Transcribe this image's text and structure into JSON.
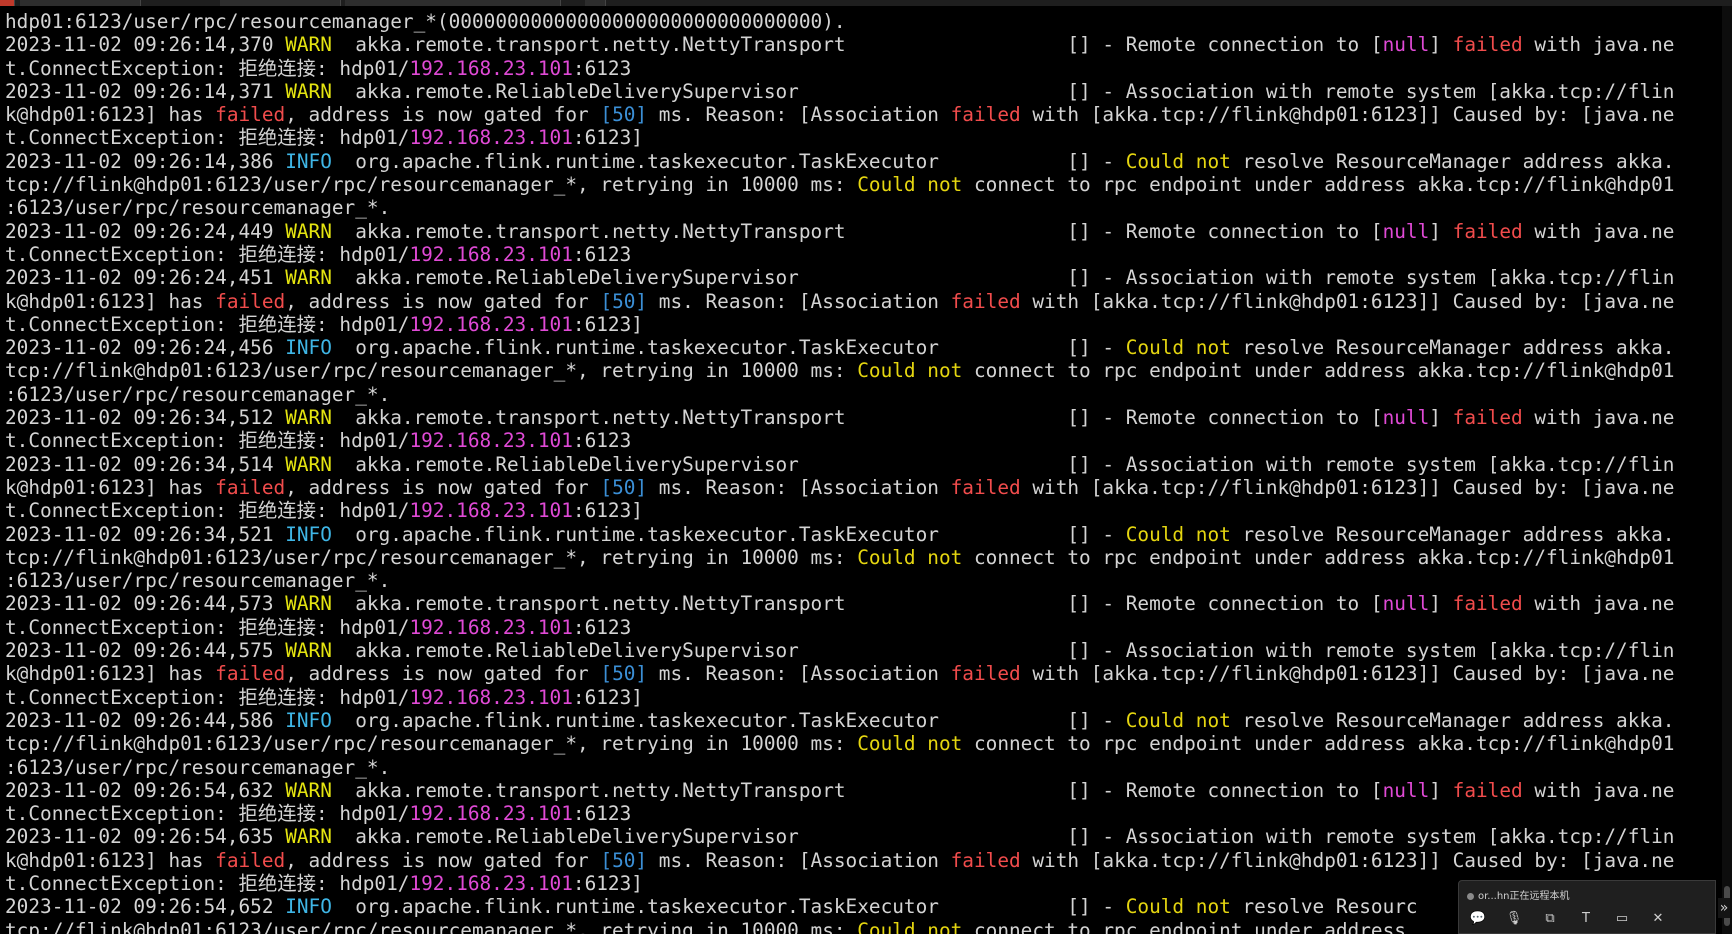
{
  "terminal": {
    "lines": [
      {
        "segs": [
          {
            "t": "hdp01:6123/user/rpc/resourcemanager_*(00000000000000000000000000000000)."
          }
        ]
      },
      {
        "segs": [
          {
            "t": "2023-11-02 09:26:14,370 "
          },
          {
            "t": "WARN",
            "c": "warn"
          },
          {
            "t": "  akka.remote.transport.netty.NettyTransport                   [] - Remote connection to ["
          },
          {
            "t": "null",
            "c": "mag"
          },
          {
            "t": "] "
          },
          {
            "t": "failed",
            "c": "red"
          },
          {
            "t": " with java.ne"
          }
        ]
      },
      {
        "segs": [
          {
            "t": "t.ConnectException: "
          },
          {
            "t": "拒绝连接",
            "c": "cjk"
          },
          {
            "t": ": hdp01/"
          },
          {
            "t": "192.168.23.101",
            "c": "mag"
          },
          {
            "t": ":6123"
          }
        ]
      },
      {
        "segs": [
          {
            "t": "2023-11-02 09:26:14,371 "
          },
          {
            "t": "WARN",
            "c": "warn"
          },
          {
            "t": "  akka.remote.ReliableDeliverySupervisor                       [] - Association with remote system [akka.tcp://flin"
          }
        ]
      },
      {
        "segs": [
          {
            "t": "k@hdp01:6123] has "
          },
          {
            "t": "failed",
            "c": "red"
          },
          {
            "t": ", address is now gated for "
          },
          {
            "t": "[50]",
            "c": "blue"
          },
          {
            "t": " ms. Reason: [Association "
          },
          {
            "t": "failed",
            "c": "red"
          },
          {
            "t": " with [akka.tcp://flink@hdp01:6123]] Caused by: [java.ne"
          }
        ]
      },
      {
        "segs": [
          {
            "t": "t.ConnectException: "
          },
          {
            "t": "拒绝连接",
            "c": "cjk"
          },
          {
            "t": ": hdp01/"
          },
          {
            "t": "192.168.23.101",
            "c": "mag"
          },
          {
            "t": ":6123]"
          }
        ]
      },
      {
        "segs": [
          {
            "t": "2023-11-02 09:26:14,386 "
          },
          {
            "t": "INFO",
            "c": "info"
          },
          {
            "t": "  org.apache.flink.runtime.taskexecutor.TaskExecutor           [] - "
          },
          {
            "t": "Could not",
            "c": "yel"
          },
          {
            "t": " resolve ResourceManager address akka."
          }
        ]
      },
      {
        "segs": [
          {
            "t": "tcp://flink@hdp01:6123/user/rpc/resourcemanager_*, retrying in 10000 ms: "
          },
          {
            "t": "Could not",
            "c": "yel"
          },
          {
            "t": " connect to rpc endpoint under address akka.tcp://flink@hdp01"
          }
        ]
      },
      {
        "segs": [
          {
            "t": ":6123/user/rpc/resourcemanager_*."
          }
        ]
      },
      {
        "segs": [
          {
            "t": "2023-11-02 09:26:24,449 "
          },
          {
            "t": "WARN",
            "c": "warn"
          },
          {
            "t": "  akka.remote.transport.netty.NettyTransport                   [] - Remote connection to ["
          },
          {
            "t": "null",
            "c": "mag"
          },
          {
            "t": "] "
          },
          {
            "t": "failed",
            "c": "red"
          },
          {
            "t": " with java.ne"
          }
        ]
      },
      {
        "segs": [
          {
            "t": "t.ConnectException: "
          },
          {
            "t": "拒绝连接",
            "c": "cjk"
          },
          {
            "t": ": hdp01/"
          },
          {
            "t": "192.168.23.101",
            "c": "mag"
          },
          {
            "t": ":6123"
          }
        ]
      },
      {
        "segs": [
          {
            "t": "2023-11-02 09:26:24,451 "
          },
          {
            "t": "WARN",
            "c": "warn"
          },
          {
            "t": "  akka.remote.ReliableDeliverySupervisor                       [] - Association with remote system [akka.tcp://flin"
          }
        ]
      },
      {
        "segs": [
          {
            "t": "k@hdp01:6123] has "
          },
          {
            "t": "failed",
            "c": "red"
          },
          {
            "t": ", address is now gated for "
          },
          {
            "t": "[50]",
            "c": "blue"
          },
          {
            "t": " ms. Reason: [Association "
          },
          {
            "t": "failed",
            "c": "red"
          },
          {
            "t": " with [akka.tcp://flink@hdp01:6123]] Caused by: [java.ne"
          }
        ]
      },
      {
        "segs": [
          {
            "t": "t.ConnectException: "
          },
          {
            "t": "拒绝连接",
            "c": "cjk"
          },
          {
            "t": ": hdp01/"
          },
          {
            "t": "192.168.23.101",
            "c": "mag"
          },
          {
            "t": ":6123]"
          }
        ]
      },
      {
        "segs": [
          {
            "t": "2023-11-02 09:26:24,456 "
          },
          {
            "t": "INFO",
            "c": "info"
          },
          {
            "t": "  org.apache.flink.runtime.taskexecutor.TaskExecutor           [] - "
          },
          {
            "t": "Could not",
            "c": "yel"
          },
          {
            "t": " resolve ResourceManager address akka."
          }
        ]
      },
      {
        "segs": [
          {
            "t": "tcp://flink@hdp01:6123/user/rpc/resourcemanager_*, retrying in 10000 ms: "
          },
          {
            "t": "Could not",
            "c": "yel"
          },
          {
            "t": " connect to rpc endpoint under address akka.tcp://flink@hdp01"
          }
        ]
      },
      {
        "segs": [
          {
            "t": ":6123/user/rpc/resourcemanager_*."
          }
        ]
      },
      {
        "segs": [
          {
            "t": "2023-11-02 09:26:34,512 "
          },
          {
            "t": "WARN",
            "c": "warn"
          },
          {
            "t": "  akka.remote.transport.netty.NettyTransport                   [] - Remote connection to ["
          },
          {
            "t": "null",
            "c": "mag"
          },
          {
            "t": "] "
          },
          {
            "t": "failed",
            "c": "red"
          },
          {
            "t": " with java.ne"
          }
        ]
      },
      {
        "segs": [
          {
            "t": "t.ConnectException: "
          },
          {
            "t": "拒绝连接",
            "c": "cjk"
          },
          {
            "t": ": hdp01/"
          },
          {
            "t": "192.168.23.101",
            "c": "mag"
          },
          {
            "t": ":6123"
          }
        ]
      },
      {
        "segs": [
          {
            "t": "2023-11-02 09:26:34,514 "
          },
          {
            "t": "WARN",
            "c": "warn"
          },
          {
            "t": "  akka.remote.ReliableDeliverySupervisor                       [] - Association with remote system [akka.tcp://flin"
          }
        ]
      },
      {
        "segs": [
          {
            "t": "k@hdp01:6123] has "
          },
          {
            "t": "failed",
            "c": "red"
          },
          {
            "t": ", address is now gated for "
          },
          {
            "t": "[50]",
            "c": "blue"
          },
          {
            "t": " ms. Reason: [Association "
          },
          {
            "t": "failed",
            "c": "red"
          },
          {
            "t": " with [akka.tcp://flink@hdp01:6123]] Caused by: [java.ne"
          }
        ]
      },
      {
        "segs": [
          {
            "t": "t.ConnectException: "
          },
          {
            "t": "拒绝连接",
            "c": "cjk"
          },
          {
            "t": ": hdp01/"
          },
          {
            "t": "192.168.23.101",
            "c": "mag"
          },
          {
            "t": ":6123]"
          }
        ]
      },
      {
        "segs": [
          {
            "t": "2023-11-02 09:26:34,521 "
          },
          {
            "t": "INFO",
            "c": "info"
          },
          {
            "t": "  org.apache.flink.runtime.taskexecutor.TaskExecutor           [] - "
          },
          {
            "t": "Could not",
            "c": "yel"
          },
          {
            "t": " resolve ResourceManager address akka."
          }
        ]
      },
      {
        "segs": [
          {
            "t": "tcp://flink@hdp01:6123/user/rpc/resourcemanager_*, retrying in 10000 ms: "
          },
          {
            "t": "Could not",
            "c": "yel"
          },
          {
            "t": " connect to rpc endpoint under address akka.tcp://flink@hdp01"
          }
        ]
      },
      {
        "segs": [
          {
            "t": ":6123/user/rpc/resourcemanager_*."
          }
        ]
      },
      {
        "segs": [
          {
            "t": "2023-11-02 09:26:44,573 "
          },
          {
            "t": "WARN",
            "c": "warn"
          },
          {
            "t": "  akka.remote.transport.netty.NettyTransport                   [] - Remote connection to ["
          },
          {
            "t": "null",
            "c": "mag"
          },
          {
            "t": "] "
          },
          {
            "t": "failed",
            "c": "red"
          },
          {
            "t": " with java.ne"
          }
        ]
      },
      {
        "segs": [
          {
            "t": "t.ConnectException: "
          },
          {
            "t": "拒绝连接",
            "c": "cjk"
          },
          {
            "t": ": hdp01/"
          },
          {
            "t": "192.168.23.101",
            "c": "mag"
          },
          {
            "t": ":6123"
          }
        ]
      },
      {
        "segs": [
          {
            "t": "2023-11-02 09:26:44,575 "
          },
          {
            "t": "WARN",
            "c": "warn"
          },
          {
            "t": "  akka.remote.ReliableDeliverySupervisor                       [] - Association with remote system [akka.tcp://flin"
          }
        ]
      },
      {
        "segs": [
          {
            "t": "k@hdp01:6123] has "
          },
          {
            "t": "failed",
            "c": "red"
          },
          {
            "t": ", address is now gated for "
          },
          {
            "t": "[50]",
            "c": "blue"
          },
          {
            "t": " ms. Reason: [Association "
          },
          {
            "t": "failed",
            "c": "red"
          },
          {
            "t": " with [akka.tcp://flink@hdp01:6123]] Caused by: [java.ne"
          }
        ]
      },
      {
        "segs": [
          {
            "t": "t.ConnectException: "
          },
          {
            "t": "拒绝连接",
            "c": "cjk"
          },
          {
            "t": ": hdp01/"
          },
          {
            "t": "192.168.23.101",
            "c": "mag"
          },
          {
            "t": ":6123]"
          }
        ]
      },
      {
        "segs": [
          {
            "t": "2023-11-02 09:26:44,586 "
          },
          {
            "t": "INFO",
            "c": "info"
          },
          {
            "t": "  org.apache.flink.runtime.taskexecutor.TaskExecutor           [] - "
          },
          {
            "t": "Could not",
            "c": "yel"
          },
          {
            "t": " resolve ResourceManager address akka."
          }
        ]
      },
      {
        "segs": [
          {
            "t": "tcp://flink@hdp01:6123/user/rpc/resourcemanager_*, retrying in 10000 ms: "
          },
          {
            "t": "Could not",
            "c": "yel"
          },
          {
            "t": " connect to rpc endpoint under address akka.tcp://flink@hdp01"
          }
        ]
      },
      {
        "segs": [
          {
            "t": ":6123/user/rpc/resourcemanager_*."
          }
        ]
      },
      {
        "segs": [
          {
            "t": "2023-11-02 09:26:54,632 "
          },
          {
            "t": "WARN",
            "c": "warn"
          },
          {
            "t": "  akka.remote.transport.netty.NettyTransport                   [] - Remote connection to ["
          },
          {
            "t": "null",
            "c": "mag"
          },
          {
            "t": "] "
          },
          {
            "t": "failed",
            "c": "red"
          },
          {
            "t": " with java.ne"
          }
        ]
      },
      {
        "segs": [
          {
            "t": "t.ConnectException: "
          },
          {
            "t": "拒绝连接",
            "c": "cjk"
          },
          {
            "t": ": hdp01/"
          },
          {
            "t": "192.168.23.101",
            "c": "mag"
          },
          {
            "t": ":6123"
          }
        ]
      },
      {
        "segs": [
          {
            "t": "2023-11-02 09:26:54,635 "
          },
          {
            "t": "WARN",
            "c": "warn"
          },
          {
            "t": "  akka.remote.ReliableDeliverySupervisor                       [] - Association with remote system [akka.tcp://flin"
          }
        ]
      },
      {
        "segs": [
          {
            "t": "k@hdp01:6123] has "
          },
          {
            "t": "failed",
            "c": "red"
          },
          {
            "t": ", address is now gated for "
          },
          {
            "t": "[50]",
            "c": "blue"
          },
          {
            "t": " ms. Reason: [Association "
          },
          {
            "t": "failed",
            "c": "red"
          },
          {
            "t": " with [akka.tcp://flink@hdp01:6123]] Caused by: [java.ne"
          }
        ]
      },
      {
        "segs": [
          {
            "t": "t.ConnectException: "
          },
          {
            "t": "拒绝连接",
            "c": "cjk"
          },
          {
            "t": ": hdp01/"
          },
          {
            "t": "192.168.23.101",
            "c": "mag"
          },
          {
            "t": ":6123]"
          }
        ]
      },
      {
        "segs": [
          {
            "t": "2023-11-02 09:26:54,652 "
          },
          {
            "t": "INFO",
            "c": "info"
          },
          {
            "t": "  org.apache.flink.runtime.taskexecutor.TaskExecutor           [] - "
          },
          {
            "t": "Could not",
            "c": "yel"
          },
          {
            "t": " resolve Resourc"
          }
        ]
      },
      {
        "segs": [
          {
            "t": "tcp://flink@hdp01:6123/user/rpc/resourcemanager_*, retrying in 10000 ms: "
          },
          {
            "t": "Could not",
            "c": "yel"
          },
          {
            "t": " connect to rpc endpoint under address"
          }
        ]
      }
    ]
  },
  "remote_panel": {
    "status_text": "or...hn正在远程本机",
    "icons": [
      {
        "name": "chat-icon",
        "glyph": "💬"
      },
      {
        "name": "microphone-icon",
        "glyph": "🎙"
      },
      {
        "name": "screen-share-icon",
        "glyph": "⧉"
      },
      {
        "name": "text-box-icon",
        "glyph": "T"
      },
      {
        "name": "folder-transfer-icon",
        "glyph": "▭"
      },
      {
        "name": "close-circle-icon",
        "glyph": "✕"
      }
    ],
    "collapse_glyph": "»"
  }
}
